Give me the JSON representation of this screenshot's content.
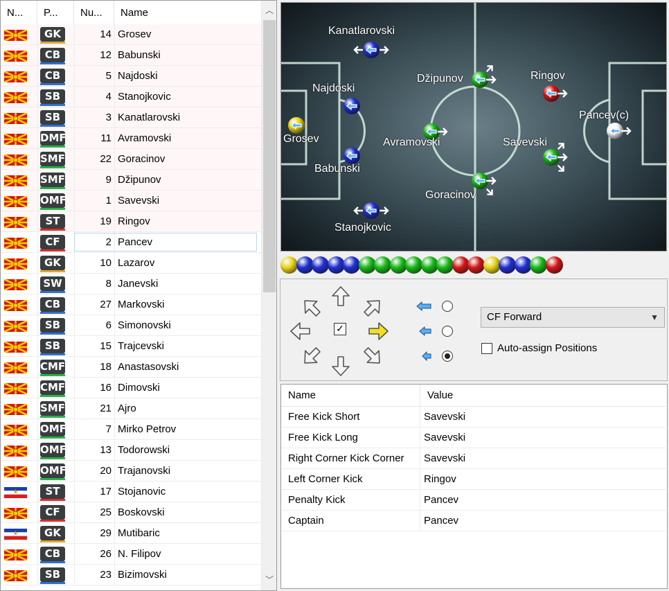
{
  "roster": {
    "headers": [
      "N...",
      "P...",
      "Nu...",
      "Name"
    ],
    "players": [
      {
        "flag": "mk",
        "pos": "GK",
        "bar": "#e0a830",
        "num": "14",
        "name": "Grosev",
        "pink": true
      },
      {
        "flag": "mk",
        "pos": "CB",
        "bar": "#2f6fd0",
        "num": "12",
        "name": "Babunski",
        "pink": true
      },
      {
        "flag": "mk",
        "pos": "CB",
        "bar": "#2f6fd0",
        "num": "5",
        "name": "Najdoski",
        "pink": true
      },
      {
        "flag": "mk",
        "pos": "SB",
        "bar": "#2f6fd0",
        "num": "4",
        "name": "Stanojkovic",
        "pink": true
      },
      {
        "flag": "mk",
        "pos": "SB",
        "bar": "#2f6fd0",
        "num": "3",
        "name": "Kanatlarovski",
        "pink": true
      },
      {
        "flag": "mk",
        "pos": "DMF",
        "bar": "#2cb04a",
        "num": "11",
        "name": "Avramovski",
        "pink": true
      },
      {
        "flag": "mk",
        "pos": "SMF",
        "bar": "#2cb04a",
        "num": "22",
        "name": "Goracinov",
        "pink": true
      },
      {
        "flag": "mk",
        "pos": "SMF",
        "bar": "#2cb04a",
        "num": "9",
        "name": "Džipunov",
        "pink": true
      },
      {
        "flag": "mk",
        "pos": "OMF",
        "bar": "#2cb04a",
        "num": "1",
        "name": "Savevski",
        "pink": true
      },
      {
        "flag": "mk",
        "pos": "ST",
        "bar": "#d83030",
        "num": "19",
        "name": "Ringov",
        "pink": true
      },
      {
        "flag": "mk",
        "pos": "CF",
        "bar": "#d83030",
        "num": "2",
        "name": "Pancev",
        "pink": false,
        "selected": true
      },
      {
        "flag": "mk",
        "pos": "GK",
        "bar": "#e0a830",
        "num": "10",
        "name": "Lazarov"
      },
      {
        "flag": "mk",
        "pos": "SW",
        "bar": "#2f6fd0",
        "num": "8",
        "name": "Janevski"
      },
      {
        "flag": "mk",
        "pos": "CB",
        "bar": "#2f6fd0",
        "num": "27",
        "name": "Markovski"
      },
      {
        "flag": "mk",
        "pos": "SB",
        "bar": "#2f6fd0",
        "num": "6",
        "name": "Simonovski"
      },
      {
        "flag": "mk",
        "pos": "SB",
        "bar": "#2f6fd0",
        "num": "15",
        "name": "Trajcevski"
      },
      {
        "flag": "mk",
        "pos": "CMF",
        "bar": "#2cb04a",
        "num": "18",
        "name": "Anastasovski"
      },
      {
        "flag": "mk",
        "pos": "CMF",
        "bar": "#2cb04a",
        "num": "16",
        "name": "Dimovski"
      },
      {
        "flag": "mk",
        "pos": "SMF",
        "bar": "#2cb04a",
        "num": "21",
        "name": "Ajro"
      },
      {
        "flag": "mk",
        "pos": "OMF",
        "bar": "#2cb04a",
        "num": "7",
        "name": "Mirko Petrov"
      },
      {
        "flag": "mk",
        "pos": "OMF",
        "bar": "#2cb04a",
        "num": "13",
        "name": "Todorowski"
      },
      {
        "flag": "mk",
        "pos": "OMF",
        "bar": "#2cb04a",
        "num": "20",
        "name": "Trajanovski"
      },
      {
        "flag": "yu",
        "pos": "ST",
        "bar": "#d83030",
        "num": "17",
        "name": "Stojanovic"
      },
      {
        "flag": "mk",
        "pos": "CF",
        "bar": "#d83030",
        "num": "25",
        "name": "Boskovski"
      },
      {
        "flag": "yu",
        "pos": "GK",
        "bar": "#e0a830",
        "num": "29",
        "name": "Mutibaric"
      },
      {
        "flag": "mk",
        "pos": "CB",
        "bar": "#2f6fd0",
        "num": "26",
        "name": "N. Filipov"
      },
      {
        "flag": "mk",
        "pos": "SB",
        "bar": "#2f6fd0",
        "num": "23",
        "name": "Bizimovski"
      }
    ]
  },
  "pitch": {
    "players": [
      {
        "name": "Kanatlarovski",
        "color": "blue",
        "arrows": "lr"
      },
      {
        "name": "Najdoski",
        "color": "blue",
        "arrows": ""
      },
      {
        "name": "Grosev",
        "color": "yellow",
        "arrows": ""
      },
      {
        "name": "Babunski",
        "color": "blue",
        "arrows": ""
      },
      {
        "name": "Stanojkovic",
        "color": "blue",
        "arrows": "lr"
      },
      {
        "name": "Džipunov",
        "color": "green",
        "arrows": "ur"
      },
      {
        "name": "Avramovski",
        "color": "green",
        "arrows": ""
      },
      {
        "name": "Goracinov",
        "color": "green",
        "arrows": "dr"
      },
      {
        "name": "Ringov",
        "color": "red",
        "arrows": ""
      },
      {
        "name": "Savevski",
        "color": "green",
        "arrows": "urdr"
      },
      {
        "name": "Pancev(c)",
        "color": "white",
        "arrows": ""
      }
    ]
  },
  "ball_strip": [
    "yellow",
    "blue",
    "blue",
    "blue",
    "blue",
    "green",
    "green",
    "green",
    "green",
    "green",
    "green",
    "red",
    "red",
    "yellow",
    "blue",
    "blue",
    "green",
    "red"
  ],
  "colors": {
    "yellow": "#e8d21a",
    "blue": "#1f2fd0",
    "green": "#18b818",
    "red": "#d01818",
    "white": "#f4f4f4"
  },
  "controls": {
    "arrow_icons": [
      "up-left-arrow-icon",
      "up-arrow-icon",
      "up-right-arrow-icon",
      "left-arrow-icon",
      "right-arrow-icon",
      "down-left-arrow-icon",
      "down-arrow-icon",
      "down-right-arrow-icon"
    ],
    "center_checked": true,
    "run_options": [
      "long",
      "medium",
      "short"
    ],
    "run_selected": 2,
    "formation_value": "CF Forward",
    "auto_assign_label": "Auto-assign Positions",
    "auto_assign_checked": false
  },
  "set_pieces": {
    "headers": [
      "Name",
      "Value"
    ],
    "rows": [
      [
        "Free Kick Short",
        "Savevski"
      ],
      [
        "Free Kick Long",
        "Savevski"
      ],
      [
        "Right Corner Kick Corner",
        "Savevski"
      ],
      [
        "Left Corner Kick",
        "Ringov"
      ],
      [
        "Penalty Kick",
        "Pancev"
      ],
      [
        "Captain",
        "Pancev"
      ]
    ]
  }
}
